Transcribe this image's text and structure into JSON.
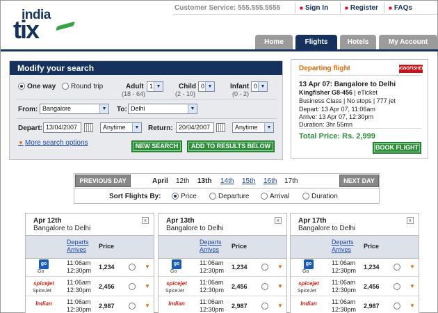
{
  "brand": {
    "logo_top": "india",
    "logo_bottom": "tix"
  },
  "header": {
    "customer_service": "Customer Service: 555.555.5555",
    "links": [
      "Sign In",
      "Register",
      "FAQs"
    ]
  },
  "nav": {
    "tabs": [
      "Home",
      "Flights",
      "Hotels",
      "My Account"
    ],
    "active": "Flights"
  },
  "search": {
    "title": "Modify your search",
    "trip_options": [
      "One way",
      "Round trip"
    ],
    "trip_selected": "One way",
    "adult": {
      "label": "Adult",
      "range": "(18 - 64)",
      "value": "1"
    },
    "child": {
      "label": "Child",
      "range": "(2 - 10)",
      "value": "0"
    },
    "infant": {
      "label": "Infant",
      "range": "(0 - 2)",
      "value": "0"
    },
    "from_label": "From:",
    "from_value": "Bangalore",
    "to_label": "To:",
    "to_value": "Delhi",
    "depart_label": "Depart:",
    "depart_date": "13/04/2007",
    "depart_time": "Anytime",
    "return_label": "Return:",
    "return_date": "20/04/2007",
    "return_time": "Anytime",
    "more_options": "More search options",
    "new_search": "NEW SEARCH",
    "add_results": "ADD TO RESULTS BELOW"
  },
  "departing": {
    "title": "Departing flight",
    "airline_logo_text": "KINGFISHER",
    "route": "13 Apr 07:  Bangalore to Delhi",
    "flight": "Kingfisher G8-456",
    "flight_extra": "|  eTicket",
    "class_info": "Business Class  |  No stops  |  777 jet",
    "depart": "Depart: 13 Apr 07, 11:06am",
    "arrive": "Arrive: 13 Apr 07, 12:30pm",
    "duration": "Duration: 3hr 55mn",
    "total_price": "Total Price:  Rs. 2,999",
    "book_button": "BOOK FLIGHT"
  },
  "days": {
    "prev": "PREVIOUS DAY",
    "next": "NEXT DAY",
    "month": "April",
    "list": [
      "12th",
      "13th",
      "14th",
      "15th",
      "16th",
      "17th"
    ]
  },
  "sort": {
    "label": "Sort Flights By:",
    "options": [
      "Price",
      "Departure",
      "Arrival",
      "Duration"
    ],
    "selected": "Price"
  },
  "results": [
    {
      "date": "Apr 12th",
      "route": "Bangalore to Delhi",
      "col_departs": "Departs",
      "col_arrives": "Arrives",
      "col_price": "Price",
      "rows": [
        {
          "airline": "Go",
          "logo": "go",
          "dep": "11:06am",
          "arr": "12:30pm",
          "price": "1,234"
        },
        {
          "airline": "SpiceJet",
          "logo": "spicejet",
          "dep": "11:06am",
          "arr": "12:30pm",
          "price": "2,456"
        },
        {
          "airline": "Indian",
          "logo": "indian",
          "dep": "11:06am",
          "arr": "12:30pm",
          "price": "2,987"
        }
      ]
    },
    {
      "date": "Apr 13th",
      "route": "Bangalore to Delhi",
      "col_departs": "Departs",
      "col_arrives": "Arrives",
      "col_price": "Price",
      "rows": [
        {
          "airline": "Go",
          "logo": "go",
          "dep": "11:06am",
          "arr": "12:30pm",
          "price": "1,234"
        },
        {
          "airline": "SpiceJet",
          "logo": "spicejet",
          "dep": "11:06am",
          "arr": "12:30pm",
          "price": "2,456"
        },
        {
          "airline": "Indian",
          "logo": "indian",
          "dep": "11:06am",
          "arr": "12:30pm",
          "price": "2,987"
        }
      ]
    },
    {
      "date": "Apr 17th",
      "route": "Bangalore to Delhi",
      "col_departs": "Departs",
      "col_arrives": "Arrives",
      "col_price": "Price",
      "rows": [
        {
          "airline": "Go",
          "logo": "go",
          "dep": "11:06am",
          "arr": "12:30pm",
          "price": "1,234"
        },
        {
          "airline": "SpiceJet",
          "logo": "spicejet",
          "dep": "11:06am",
          "arr": "12:30pm",
          "price": "2,456"
        },
        {
          "airline": "Indian",
          "logo": "indian",
          "dep": "11:06am",
          "arr": "12:30pm",
          "price": "2,987"
        }
      ]
    }
  ],
  "logo_text": {
    "go": "go",
    "spicejet": "spicejet",
    "indian": "Indian"
  },
  "colors": {
    "brand_navy": "#16325c",
    "accent_orange": "#e06a0a",
    "action_green": "#2c8f3a",
    "link_blue": "#1c48a8"
  }
}
